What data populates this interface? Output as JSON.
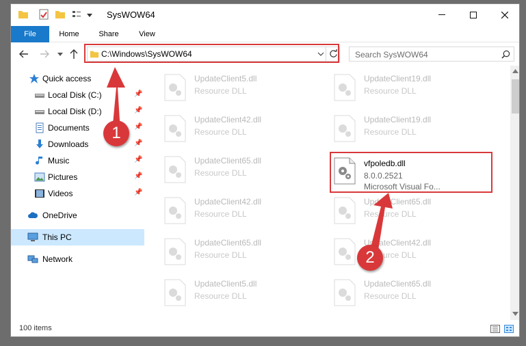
{
  "window": {
    "title": "SysWOW64"
  },
  "ribbon": {
    "tabs": [
      "File",
      "Home",
      "Share",
      "View"
    ]
  },
  "address": {
    "path": "C:\\Windows\\SysWOW64"
  },
  "search": {
    "placeholder": "Search SysWOW64"
  },
  "sidebar": {
    "items": [
      {
        "label": "Quick access",
        "icon": "star-icon"
      },
      {
        "label": "Local Disk (C:)",
        "icon": "drive-icon",
        "pinned": true
      },
      {
        "label": "Local Disk (D:)",
        "icon": "drive-icon",
        "pinned": true
      },
      {
        "label": "Documents",
        "icon": "documents-icon",
        "pinned": true
      },
      {
        "label": "Downloads",
        "icon": "downloads-icon",
        "pinned": true
      },
      {
        "label": "Music",
        "icon": "music-icon",
        "pinned": true
      },
      {
        "label": "Pictures",
        "icon": "pictures-icon",
        "pinned": true
      },
      {
        "label": "Videos",
        "icon": "videos-icon",
        "pinned": true
      },
      {
        "label": "OneDrive",
        "icon": "cloud-icon"
      },
      {
        "label": "This PC",
        "icon": "computer-icon",
        "selected": true
      },
      {
        "label": "Network",
        "icon": "network-icon"
      }
    ]
  },
  "files": {
    "left": [
      {
        "name": "UpdateClient5.dll",
        "type": "Resource DLL"
      },
      {
        "name": "UpdateClient42.dll",
        "type": "Resource DLL"
      },
      {
        "name": "UpdateClient65.dll",
        "type": "Resource DLL"
      },
      {
        "name": "UpdateClient42.dll",
        "type": "Resource DLL"
      },
      {
        "name": "UpdateClient65.dll",
        "type": "Resource DLL"
      },
      {
        "name": "UpdateClient5.dll",
        "type": "Resource DLL"
      }
    ],
    "right": [
      {
        "name": "UpdateClient19.dll",
        "type": "Resource DLL"
      },
      {
        "name": "UpdateClient19.dll",
        "type": "Resource DLL"
      },
      {
        "name": "vfpoledb.dll",
        "type": "8.0.0.2521",
        "desc": "Microsoft Visual Fo...",
        "highlight": true
      },
      {
        "name": "UpdateClient65.dll",
        "type": "Resource DLL"
      },
      {
        "name": "UpdateClient42.dll",
        "type": "Resource DLL"
      },
      {
        "name": "UpdateClient65.dll",
        "type": "Resource DLL"
      }
    ]
  },
  "status": {
    "count": "100 items"
  },
  "annotations": {
    "badge1": "1",
    "badge2": "2",
    "color": "#d9383a"
  }
}
